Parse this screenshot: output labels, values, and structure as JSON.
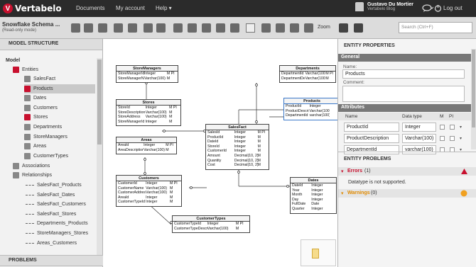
{
  "brand": "Vertabelo",
  "nav": {
    "documents": "Documents",
    "account": "My account",
    "help": "Help ▾"
  },
  "user": {
    "name": "Gustavo Du Mortier",
    "org": "Vertabelo Blog",
    "logout": "Log out"
  },
  "toolbar": {
    "model_name": "Snowflake Schema ...",
    "read_only": "(Read-only mode)",
    "zoom": "Zoom",
    "search_placeholder": "Search (Ctrl+F)"
  },
  "left": {
    "model_structure": "MODEL STRUCTURE",
    "model": "Model",
    "entities": "Entities",
    "entity_items": [
      "SalesFact",
      "Products",
      "Dates",
      "Customers",
      "Stores",
      "Departments",
      "StoreManagers",
      "Areas",
      "CustomerTypes"
    ],
    "associations": "Associations",
    "relationships": "Relationships",
    "relationship_items": [
      "SalesFact_Products",
      "SalesFact_Dates",
      "SalesFact_Customers",
      "SalesFact_Stores",
      "Departments_Products",
      "StoreManagers_Stores",
      "Areas_Customers",
      "CustomerTypes_Custo..."
    ],
    "problems": "PROBLEMS"
  },
  "right": {
    "title": "ENTITY PROPERTIES",
    "general": "General",
    "name_label": "Name:",
    "name_value": "Products",
    "comment_label": "Comment:",
    "attributes": "Attributes",
    "attr_headers": {
      "name": "Name",
      "type": "Data type",
      "m": "M",
      "pi": "PI"
    },
    "attributes_list": [
      {
        "name": "ProductId",
        "type": "Integer"
      },
      {
        "name": "ProductDescription",
        "type": "Varchar(100)"
      },
      {
        "name": "DepartmentId",
        "type": "varchar(100)"
      }
    ],
    "problems_title": "ENTITY PROBLEMS",
    "errors": "Errors",
    "errors_count": "(1)",
    "error_msg": "Datatype is not supported.",
    "warnings": "Warnings",
    "warnings_count": "(0)"
  },
  "entities": {
    "storemanagers": {
      "title": "StoreManagers",
      "rows": [
        [
          "StoreManagerId",
          "Integer",
          "M PI"
        ],
        [
          "StoreManagerName",
          "Varchar(100)",
          "M"
        ]
      ]
    },
    "stores": {
      "title": "Stores",
      "rows": [
        [
          "StoreId",
          "Integer",
          "M PI"
        ],
        [
          "StoreDescription",
          "Varchar(100)",
          "M"
        ],
        [
          "StoreAddress",
          "Varchar(100)",
          "M"
        ],
        [
          "StoreManagerId",
          "Integer",
          "M"
        ]
      ]
    },
    "areas": {
      "title": "Areas",
      "rows": [
        [
          "AreaId",
          "Integer",
          "M PI"
        ],
        [
          "AreaDescription",
          "Varchar(100)",
          "M"
        ]
      ]
    },
    "customers": {
      "title": "Customers",
      "rows": [
        [
          "CustomerId",
          "Integer",
          "M PI"
        ],
        [
          "CustomerName",
          "Varchar(100)",
          "M"
        ],
        [
          "CustomerAddress",
          "Varchar(100)",
          "M"
        ],
        [
          "AreaId",
          "Integer",
          "M"
        ],
        [
          "CustomerTypeId",
          "Integer",
          "M"
        ]
      ]
    },
    "customertypes": {
      "title": "CustomerTypes",
      "rows": [
        [
          "CustomerTypeId",
          "Integer",
          "M PI"
        ],
        [
          "CustomerTypeDescription",
          "Varchar(100)",
          "M"
        ]
      ]
    },
    "salesfact": {
      "title": "SalesFact",
      "rows": [
        [
          "SalesId",
          "Integer",
          "M PI"
        ],
        [
          "ProductId",
          "Integer",
          "M"
        ],
        [
          "DateId",
          "Integer",
          "M"
        ],
        [
          "StoreId",
          "Integer",
          "M"
        ],
        [
          "CustomerId",
          "Integer",
          "M"
        ],
        [
          "Amount",
          "Decimal(10, 2)",
          "M"
        ],
        [
          "Quantity",
          "Decimal(10, 2)",
          "M"
        ],
        [
          "Cost",
          "Decimal(10, 2)",
          "M"
        ]
      ]
    },
    "departments": {
      "title": "Departments",
      "rows": [
        [
          "DepartmentId",
          "Varchar(100)",
          "M PI"
        ],
        [
          "DepartmentDesc",
          "Varchar(100)",
          "M"
        ]
      ]
    },
    "products": {
      "title": "Products",
      "rows": [
        [
          "ProductId",
          "Integer",
          ""
        ],
        [
          "ProductDescription",
          "Varchar(100)",
          ""
        ],
        [
          "DepartmentId",
          "varchar(100)",
          ""
        ]
      ]
    },
    "dates": {
      "title": "Dates",
      "rows": [
        [
          "DateId",
          "Integer",
          ""
        ],
        [
          "Year",
          "Integer",
          ""
        ],
        [
          "Month",
          "Integer",
          ""
        ],
        [
          "Day",
          "Integer",
          ""
        ],
        [
          "FullDate",
          "Date",
          ""
        ],
        [
          "Quarter",
          "Integer",
          ""
        ]
      ]
    }
  }
}
